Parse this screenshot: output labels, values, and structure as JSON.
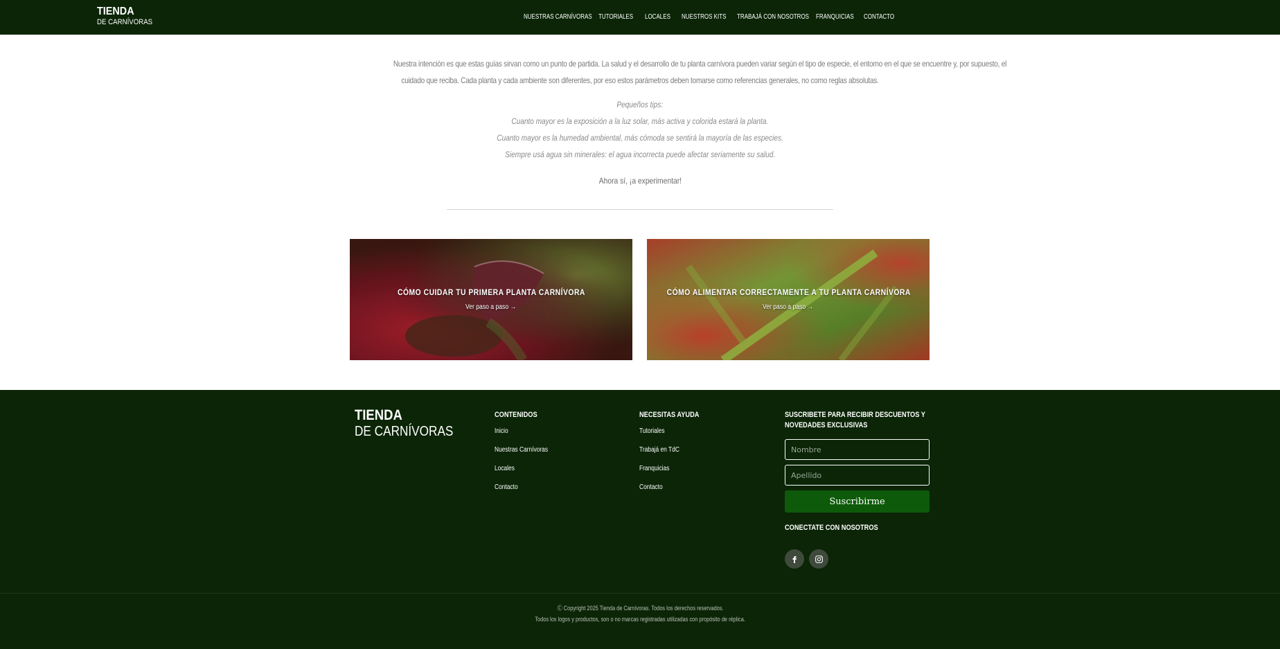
{
  "colors": {
    "header_bg": "#0b2506",
    "footer_bg": "#0b2506",
    "button_bg": "#0d5b0a",
    "text_muted": "#7b7b7b"
  },
  "header": {
    "brand_line1": "TIENDA",
    "brand_line2": "DE CARNÍVORAS",
    "nav": [
      "NUESTRAS CARNÍVORAS",
      "TUTORIALES",
      "LOCALES",
      "NUESTROS KITS",
      "TRABAJÁ CON NOSOTROS",
      "FRANQUICIAS",
      "CONTACTO"
    ]
  },
  "intro": {
    "paragraph_line1": "Nuestra intención es que estas guías sirvan como un punto de partida. La salud y el desarrollo de tu planta carnívora pueden variar según el tipo de especie, el entorno en el que se encuentre y, por supuesto, el",
    "paragraph_line2": "cuidado que reciba. Cada planta y cada ambiente son diferentes, por eso estos parámetros deben tomarse como referencias generales, no como reglas absolutas.",
    "tips_heading": "Pequeños tips:",
    "tips": [
      "Cuanto mayor es la exposición a la luz solar, más activa y colorida estará la planta.",
      "Cuanto mayor es la humedad ambiental, más cómoda se sentirá la mayoría de las especies.",
      "Siempre usá agua sin minerales: el agua incorrecta puede afectar seriamente su salud."
    ],
    "closing": "Ahora sí, ¡a experimentar!"
  },
  "cards": [
    {
      "title": "CÓMO CUIDAR TU PRIMERA PLANTA CARNÍVORA",
      "link": "Ver paso a paso →",
      "image": "venus-flytrap-photo"
    },
    {
      "title": "CÓMO ALIMENTAR CORRECTAMENTE A TU PLANTA CARNÍVORA",
      "link": "Ver paso a paso →",
      "image": "sundew-photo"
    }
  ],
  "footer": {
    "brand_line1": "TIENDA",
    "brand_line2": "DE CARNÍVORAS",
    "col1_title": "CONTENIDOS",
    "col1_links": [
      "Inicio",
      "Nuestras Carnívoras",
      "Locales",
      "Contacto"
    ],
    "col2_title": "NECESITAS AYUDA",
    "col2_links": [
      "Tutoriales",
      "Trabajá en TdC",
      "Franquicias",
      "Contacto"
    ],
    "subscribe_title_line1": "SUSCRIBETE PARA RECIBIR DESCUENTOS Y",
    "subscribe_title_line2": "NOVEDADES EXCLUSIVAS",
    "name_placeholder": "Nombre",
    "surname_placeholder": "Apellido",
    "subscribe_button": "Suscribirme",
    "connect_title": "CONECTATE CON NOSOTROS",
    "social_icons": [
      "facebook-icon",
      "instagram-icon"
    ],
    "copyright": "Ⓒ Copyright 2025 Tienda de Carnívoras. Todos los derechos reservados.",
    "disclaimer": "Todos los logos y productos, son o no marcas registradas utilizadas con propósito de réplica."
  }
}
